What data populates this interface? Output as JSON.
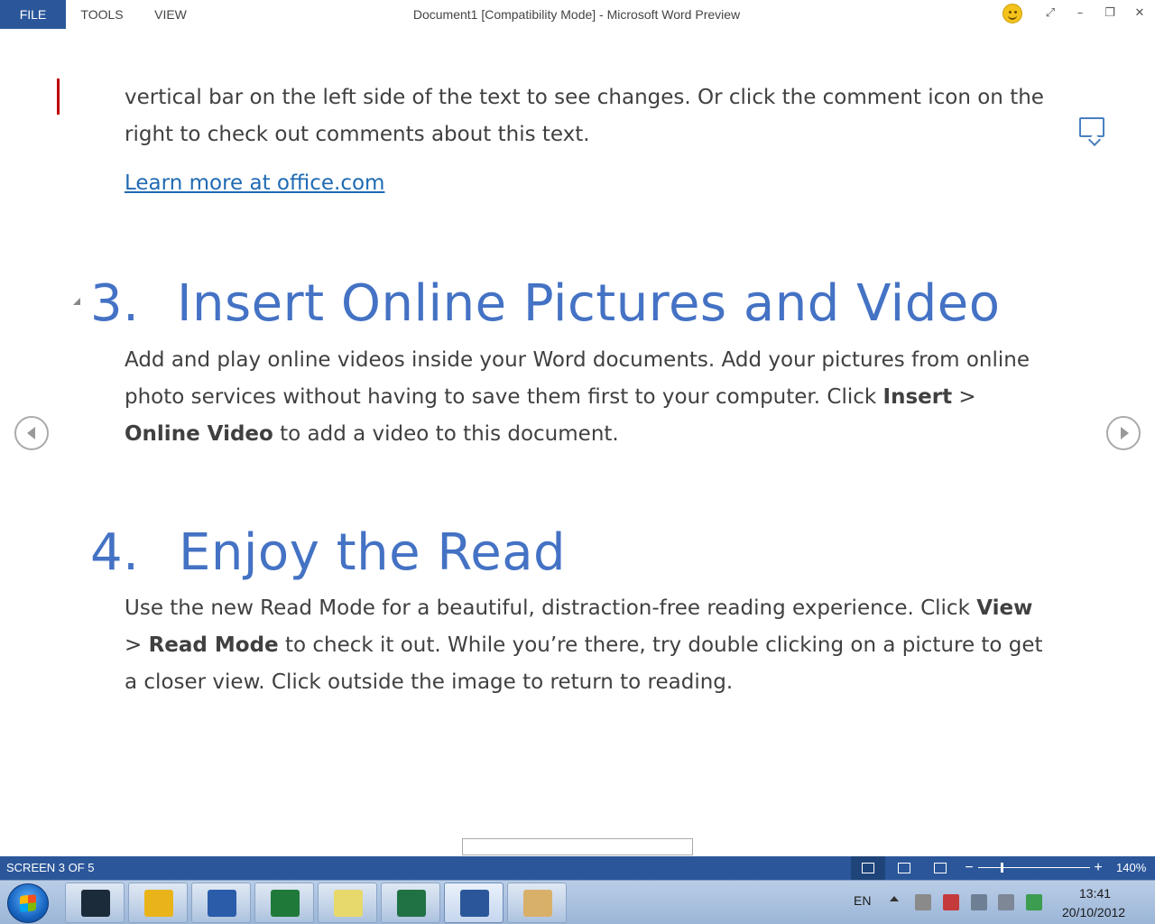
{
  "menu": {
    "file": "FILE",
    "tools": "TOOLS",
    "view": "VIEW"
  },
  "window": {
    "title": "Document1 [Compatibility Mode] - Microsoft Word Preview",
    "minimize": "–",
    "restore": "❐",
    "close": "✕",
    "fullscreen": "⤢"
  },
  "document": {
    "para_top": "vertical bar on the left side of the text to see changes. Or click the comment icon on the right to check out comments about this text.",
    "link": "Learn more at office.com",
    "section3": {
      "number": "3.",
      "title": "Insert Online Pictures and Video",
      "text_a": "Add and play online videos inside your Word documents. Add your pictures from online photo services without having to save them first to your computer. Click ",
      "bold_1": "Insert",
      "text_b": " > ",
      "bold_2": "Online Video",
      "text_c": " to add a video to this document."
    },
    "section4": {
      "number": "4.",
      "title": "Enjoy the Read",
      "text_a": "Use the new Read Mode for a beautiful, distraction-free reading experience. Click ",
      "bold_1": "View",
      "text_b": " > ",
      "bold_2": "Read Mode",
      "text_c": " to check it out. While you’re there, try double clicking on a picture to get a closer view. Click outside the image to return to reading."
    }
  },
  "statusbar": {
    "screen": "SCREEN 3 OF 5",
    "zoom_minus": "−",
    "zoom_plus": "+",
    "zoom_level": "140%",
    "zoom_fraction": 0.2
  },
  "taskbar": {
    "apps": [
      {
        "name": "skull-app",
        "color": "#1c2b3a"
      },
      {
        "name": "chrome-canary",
        "color": "#e8b419"
      },
      {
        "name": "word-2010",
        "color": "#2a5caa"
      },
      {
        "name": "excel-2010",
        "color": "#1f7a3a"
      },
      {
        "name": "sticky-notes",
        "color": "#e7d96b"
      },
      {
        "name": "excel-2013",
        "color": "#207245"
      },
      {
        "name": "word-2013",
        "color": "#2b579a"
      },
      {
        "name": "paint",
        "color": "#d9b06a"
      }
    ],
    "language": "EN",
    "time": "13:41",
    "date": "20/10/2012"
  }
}
